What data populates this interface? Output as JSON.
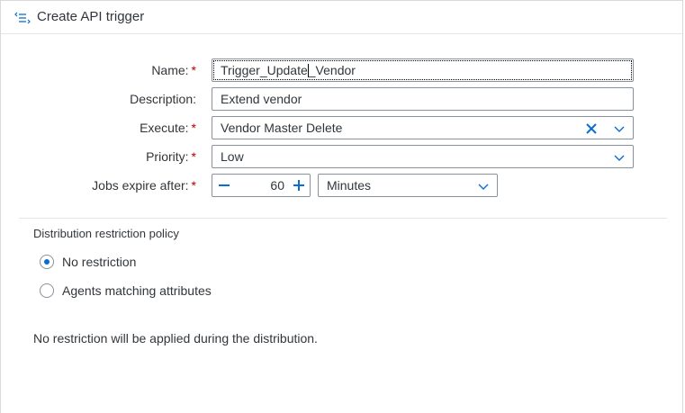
{
  "dialog": {
    "title": "Create API trigger",
    "icon": "list-icon"
  },
  "form": {
    "name": {
      "label": "Name:",
      "value_before_caret": "Trigger_Update",
      "value_after_caret": "_Vendor",
      "required": true
    },
    "description": {
      "label": "Description:",
      "value": "Extend vendor",
      "required": false
    },
    "execute": {
      "label": "Execute:",
      "value": "Vendor Master Delete",
      "required": true
    },
    "priority": {
      "label": "Priority:",
      "value": "Low",
      "required": true
    },
    "jobs_expire": {
      "label": "Jobs expire after:",
      "value": "60",
      "unit": "Minutes",
      "required": true
    }
  },
  "required_marker": "*",
  "distribution": {
    "title": "Distribution restriction policy",
    "options": [
      {
        "label": "No restriction",
        "selected": true
      },
      {
        "label": "Agents matching attributes",
        "selected": false
      }
    ],
    "info": "No restriction will be applied during the distribution."
  },
  "colors": {
    "accent": "#0a6ed1",
    "required": "#bb0000",
    "text": "#32363a",
    "border": "#89919a"
  }
}
